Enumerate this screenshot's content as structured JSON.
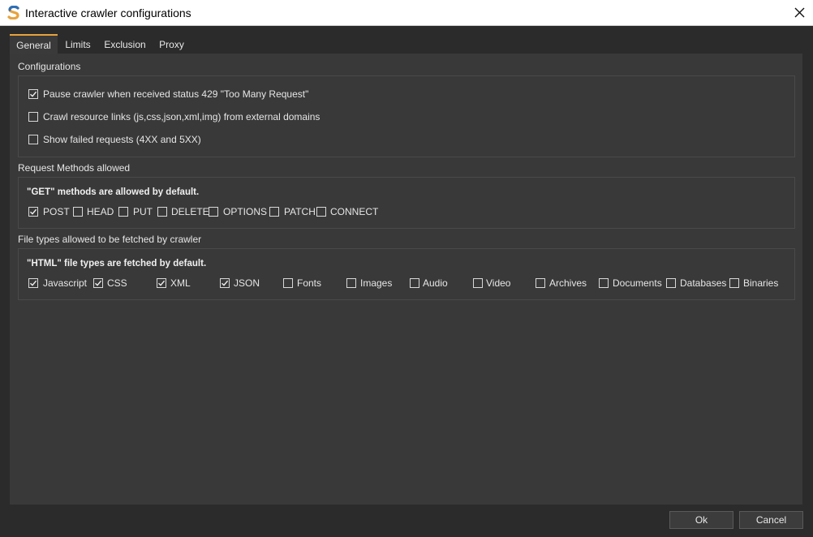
{
  "window": {
    "title": "Interactive crawler configurations"
  },
  "tabs": [
    {
      "label": "General",
      "active": true
    },
    {
      "label": "Limits",
      "active": false
    },
    {
      "label": "Exclusion",
      "active": false
    },
    {
      "label": "Proxy",
      "active": false
    }
  ],
  "configurations": {
    "label": "Configurations",
    "options": [
      {
        "label": "Pause crawler when received status 429 \"Too Many Request\"",
        "checked": true
      },
      {
        "label": "Crawl resource links (js,css,json,xml,img) from external domains",
        "checked": false
      },
      {
        "label": "Show failed requests (4XX and 5XX)",
        "checked": false
      }
    ]
  },
  "request_methods": {
    "label": "Request Methods allowed",
    "note": "\"GET\" methods are allowed by default.",
    "options": [
      {
        "label": "POST",
        "checked": true
      },
      {
        "label": "HEAD",
        "checked": false
      },
      {
        "label": "PUT",
        "checked": false
      },
      {
        "label": "DELETE",
        "checked": false
      },
      {
        "label": "OPTIONS",
        "checked": false
      },
      {
        "label": "PATCH",
        "checked": false
      },
      {
        "label": "CONNECT",
        "checked": false
      }
    ]
  },
  "file_types": {
    "label": "File types allowed to be fetched by crawler",
    "note": "\"HTML\" file types are fetched by default.",
    "options": [
      {
        "label": "Javascript",
        "checked": true
      },
      {
        "label": "CSS",
        "checked": true
      },
      {
        "label": "XML",
        "checked": true
      },
      {
        "label": "JSON",
        "checked": true
      },
      {
        "label": "Fonts",
        "checked": false
      },
      {
        "label": "Images",
        "checked": false
      },
      {
        "label": "Audio",
        "checked": false
      },
      {
        "label": "Video",
        "checked": false
      },
      {
        "label": "Archives",
        "checked": false
      },
      {
        "label": "Documents",
        "checked": false
      },
      {
        "label": "Databases",
        "checked": false
      },
      {
        "label": "Binaries",
        "checked": false
      }
    ]
  },
  "buttons": {
    "ok": "Ok",
    "cancel": "Cancel"
  },
  "colors": {
    "accent": "#e8a33d",
    "panel": "#393939",
    "background": "#2b2b2b"
  }
}
